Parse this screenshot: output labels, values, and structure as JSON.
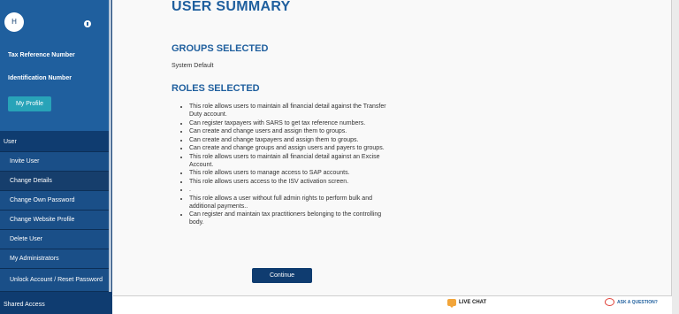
{
  "sidebar": {
    "avatar_initial": "H",
    "tax_reference_label": "Tax Reference Number",
    "identification_label": "Identification Number",
    "profile_button": "My Profile",
    "menu_header": "User",
    "items": [
      {
        "label": "Invite User"
      },
      {
        "label": "Change Details"
      },
      {
        "label": "Change Own Password"
      },
      {
        "label": "Change Website Profile"
      },
      {
        "label": "Delete User"
      },
      {
        "label": "My Administrators"
      },
      {
        "label": "Unlock Account / Reset Password"
      }
    ],
    "shared_access": "Shared Access"
  },
  "main": {
    "title": "USER SUMMARY",
    "groups_heading": "GROUPS SELECTED",
    "group_value": "System Default",
    "roles_heading": "ROLES SELECTED",
    "roles": [
      "This role allows users to maintain all financial detail against the Transfer Duty account.",
      "Can register taxpayers with SARS to get tax reference numbers.",
      "Can create and change users and assign them to groups.",
      "Can create and change taxpayers and assign them to groups.",
      "Can create and change groups and assign users and payers to groups.",
      "This role allows users to maintain all financial detail against an Excise Account.",
      "This role allows users to manage access to SAP accounts.",
      "This role allows users access to the ISV activation screen.",
      ".",
      "This role allows a user without full admin rights to perform bulk and additional payments..",
      "Can register and maintain tax practitioners belonging to the controlling body."
    ],
    "continue_button": "Continue"
  },
  "footer": {
    "live_chat": "LIVE CHAT",
    "ask_question": "ASK A QUESTION?"
  },
  "colors": {
    "sidebar_dark": "#0f3c70",
    "sidebar_light": "#1f5f9e",
    "accent_teal": "#28a3b8",
    "heading_blue": "#1f5f9e"
  }
}
